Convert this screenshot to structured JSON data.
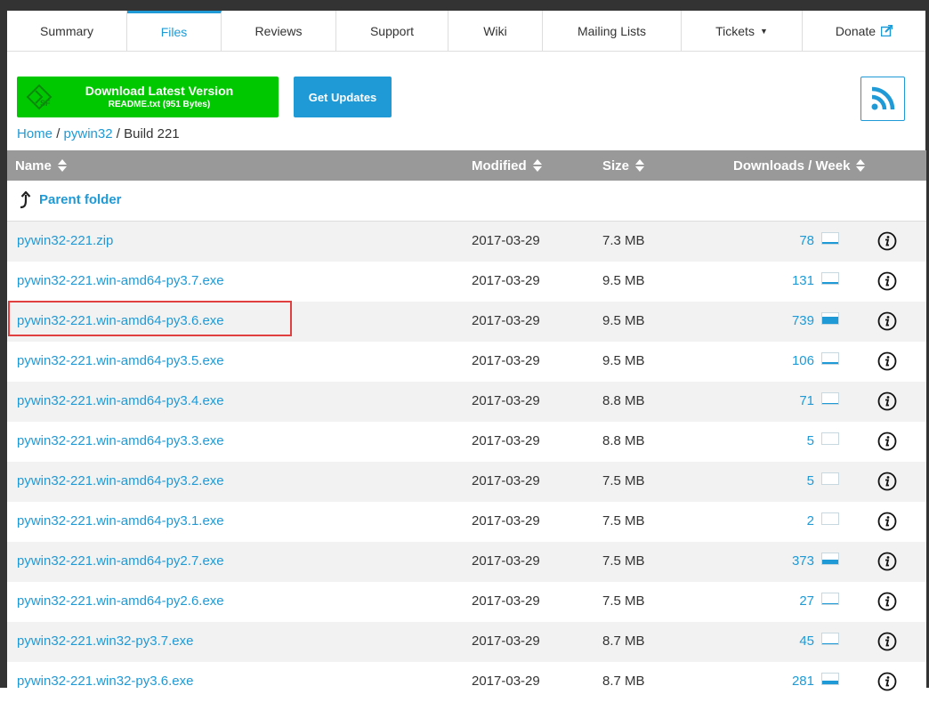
{
  "tabs": [
    {
      "label": "Summary",
      "active": false
    },
    {
      "label": "Files",
      "active": true
    },
    {
      "label": "Reviews",
      "active": false
    },
    {
      "label": "Support",
      "active": false
    },
    {
      "label": "Wiki",
      "active": false
    },
    {
      "label": "Mailing Lists",
      "active": false
    },
    {
      "label": "Tickets",
      "active": false
    },
    {
      "label": "Donate",
      "active": false
    }
  ],
  "download": {
    "title": "Download Latest Version",
    "subtitle": "README.txt (951 Bytes)"
  },
  "get_updates_label": "Get Updates",
  "breadcrumb": {
    "home": "Home",
    "sep": "/",
    "project": "pywin32",
    "current": "Build 221"
  },
  "columns": {
    "name": "Name",
    "modified": "Modified",
    "size": "Size",
    "downloads": "Downloads / Week"
  },
  "parent_folder": "Parent folder",
  "files": [
    {
      "name": "pywin32-221.zip",
      "modified": "2017-03-29",
      "size": "7.3 MB",
      "downloads": "78",
      "spark_fill": 0.15
    },
    {
      "name": "pywin32-221.win-amd64-py3.7.exe",
      "modified": "2017-03-29",
      "size": "9.5 MB",
      "downloads": "131",
      "spark_fill": 0.2
    },
    {
      "name": "pywin32-221.win-amd64-py3.6.exe",
      "modified": "2017-03-29",
      "size": "9.5 MB",
      "downloads": "739",
      "spark_fill": 0.7
    },
    {
      "name": "pywin32-221.win-amd64-py3.5.exe",
      "modified": "2017-03-29",
      "size": "9.5 MB",
      "downloads": "106",
      "spark_fill": 0.15
    },
    {
      "name": "pywin32-221.win-amd64-py3.4.exe",
      "modified": "2017-03-29",
      "size": "8.8 MB",
      "downloads": "71",
      "spark_fill": 0.12
    },
    {
      "name": "pywin32-221.win-amd64-py3.3.exe",
      "modified": "2017-03-29",
      "size": "8.8 MB",
      "downloads": "5",
      "spark_fill": 0
    },
    {
      "name": "pywin32-221.win-amd64-py3.2.exe",
      "modified": "2017-03-29",
      "size": "7.5 MB",
      "downloads": "5",
      "spark_fill": 0
    },
    {
      "name": "pywin32-221.win-amd64-py3.1.exe",
      "modified": "2017-03-29",
      "size": "7.5 MB",
      "downloads": "2",
      "spark_fill": 0
    },
    {
      "name": "pywin32-221.win-amd64-py2.7.exe",
      "modified": "2017-03-29",
      "size": "7.5 MB",
      "downloads": "373",
      "spark_fill": 0.45
    },
    {
      "name": "pywin32-221.win-amd64-py2.6.exe",
      "modified": "2017-03-29",
      "size": "7.5 MB",
      "downloads": "27",
      "spark_fill": 0.05
    },
    {
      "name": "pywin32-221.win32-py3.7.exe",
      "modified": "2017-03-29",
      "size": "8.7 MB",
      "downloads": "45",
      "spark_fill": 0.1
    },
    {
      "name": "pywin32-221.win32-py3.6.exe",
      "modified": "2017-03-29",
      "size": "8.7 MB",
      "downloads": "281",
      "spark_fill": 0.35
    }
  ],
  "colors": {
    "accent": "#1f9ad6",
    "download_green": "#00c800",
    "header_gray": "#999999",
    "highlight_red": "#e0403f"
  }
}
